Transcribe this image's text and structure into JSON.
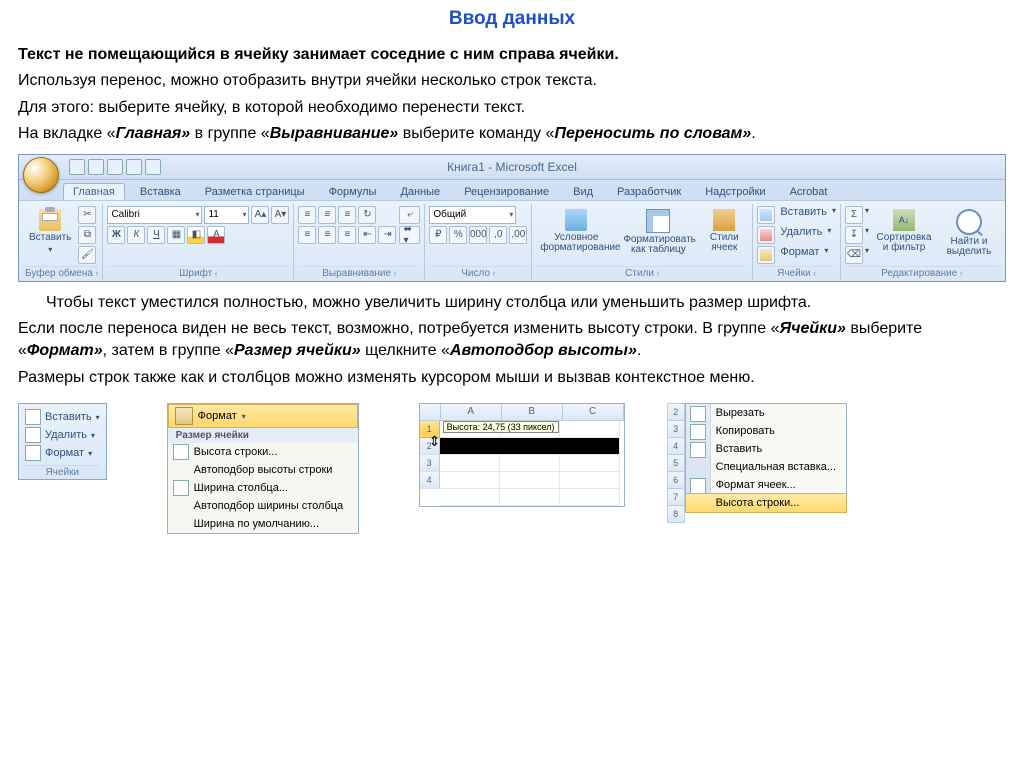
{
  "title": "Ввод данных",
  "p1": "Текст не помещающийся в ячейку занимает соседние с ним справа ячейки.",
  "p2": "Используя перенос, можно отобразить внутри ячейки несколько строк текста.",
  "p3": "Для этого: выберите ячейку, в которой необходимо перенести текст.",
  "p4a": "На вкладке «",
  "p4b": "Главная»",
  "p4c": " в группе «",
  "p4d": "Выравнивание»",
  "p4e": " выберите команду «",
  "p4f": "Переносить по словам»",
  "p4g": ".",
  "p5": "Чтобы текст уместился полностью, можно увеличить ширину столбца или уменьшить размер шрифта.",
  "p6a": "Если после переноса виден не весь текст, возможно, потребуется изменить высоту строки. В группе «",
  "p6b": "Ячейки»",
  "p6c": " выберите «",
  "p6d": "Формат»",
  "p6e": ", затем в группе «",
  "p6f": "Размер ячейки»",
  "p6g": " щелкните «",
  "p6h": "Автоподбор высоты»",
  "p6i": ".",
  "p7": "Размеры строк также как и столбцов можно изменять курсором мыши и вызвав контекстное меню.",
  "ribbon": {
    "window_title": "Книга1 - Microsoft Excel",
    "tabs": [
      "Главная",
      "Вставка",
      "Разметка страницы",
      "Формулы",
      "Данные",
      "Рецензирование",
      "Вид",
      "Разработчик",
      "Надстройки",
      "Acrobat"
    ],
    "groups": {
      "clipboard": {
        "label": "Буфер обмена",
        "paste": "Вставить"
      },
      "font": {
        "label": "Шрифт",
        "name": "Calibri",
        "size": "11"
      },
      "align": {
        "label": "Выравнивание"
      },
      "number": {
        "label": "Число",
        "format": "Общий"
      },
      "styles": {
        "label": "Стили",
        "cond": "Условное форматирование",
        "table": "Форматировать как таблицу",
        "cell": "Стили ячеек"
      },
      "cells": {
        "label": "Ячейки",
        "insert": "Вставить",
        "delete": "Удалить",
        "format": "Формат"
      },
      "editing": {
        "label": "Редактирование",
        "sort": "Сортировка и фильтр",
        "find": "Найти и выделить"
      }
    }
  },
  "cells_panel": {
    "insert": "Вставить",
    "delete": "Удалить",
    "format": "Формат",
    "label": "Ячейки"
  },
  "format_menu": {
    "header": "Формат",
    "section": "Размер ячейки",
    "items": [
      {
        "text": "Высота строки...",
        "u": "В"
      },
      {
        "text": "Автоподбор высоты строки",
        "u": "А"
      },
      {
        "text": "Ширина столбца...",
        "u": "Ш"
      },
      {
        "text": "Автоподбор ширины столбца"
      },
      {
        "text": "Ширина по умолчанию...",
        "u": "у"
      }
    ]
  },
  "sheet": {
    "cols": [
      "A",
      "B",
      "C"
    ],
    "rows": [
      "1",
      "2",
      "3",
      "4"
    ],
    "tooltip": "Высота: 24,75 (33 пиксел)"
  },
  "ctx": {
    "nums": [
      "2",
      "3",
      "4",
      "5",
      "6",
      "7",
      "8"
    ],
    "items": [
      {
        "t": "Вырезать",
        "u": "В"
      },
      {
        "t": "Копировать",
        "u": "К"
      },
      {
        "t": "Вставить",
        "u": "в"
      },
      {
        "t": "Специальная вставка..."
      },
      {
        "t": "Формат ячеек...",
        "u": "я"
      },
      {
        "t": "Высота строки...",
        "u": "с",
        "hl": true
      }
    ]
  }
}
